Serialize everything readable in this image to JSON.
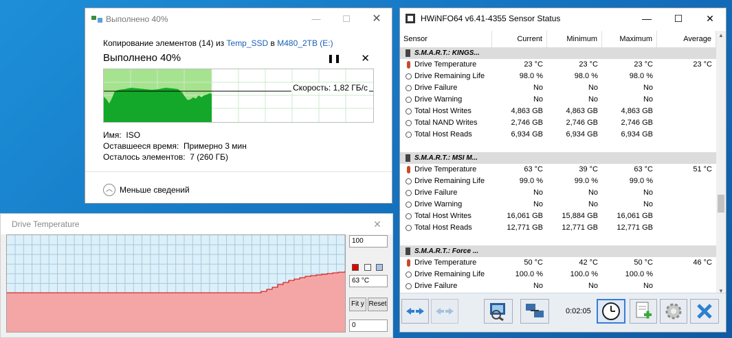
{
  "copy_dialog": {
    "title": "Выполнено 40%",
    "line_prefix": "Копирование элементов (14) из ",
    "source": "Temp_SSD",
    "line_mid": " в ",
    "destination": "M480_2TB (E:)",
    "heading": "Выполнено 40%",
    "pause_icon": "pause-icon",
    "close_icon": "close-icon",
    "speed_text": "Скорость: 1,82 ГБ/с",
    "progress_fraction": 0.4,
    "name_label": "Имя:",
    "name_value": "ISO",
    "time_label": "Оставшееся время:",
    "time_value": "Примерно 3 мин",
    "items_label": "Осталось элементов:",
    "items_value": "7 (260 ГБ)",
    "less_details": "Меньше сведений"
  },
  "temp_window": {
    "title": "Drive Temperature",
    "max_value": "100",
    "current_value": "63 °C",
    "min_value": "0",
    "fit_label": "Fit y",
    "reset_label": "Reset",
    "colors": {
      "fill": "#f4a6a6",
      "line": "#d40000",
      "background": "#dcf0fa",
      "grid": "#a8c8dc"
    }
  },
  "hwinfo": {
    "title": "HWiNFO64 v6.41-4355 Sensor Status",
    "columns": [
      "Sensor",
      "Current",
      "Minimum",
      "Maximum",
      "Average"
    ],
    "rows": [
      {
        "type": "group",
        "name": "S.M.A.R.T.: KINGS..."
      },
      {
        "type": "temp",
        "name": "Drive Temperature",
        "cur": "23 °C",
        "min": "23 °C",
        "max": "23 °C",
        "avg": "23 °C"
      },
      {
        "type": "clock",
        "name": "Drive Remaining Life",
        "cur": "98.0 %",
        "min": "98.0 %",
        "max": "98.0 %",
        "avg": ""
      },
      {
        "type": "clock",
        "name": "Drive Failure",
        "cur": "No",
        "min": "No",
        "max": "No",
        "avg": ""
      },
      {
        "type": "clock",
        "name": "Drive Warning",
        "cur": "No",
        "min": "No",
        "max": "No",
        "avg": ""
      },
      {
        "type": "clock",
        "name": "Total Host Writes",
        "cur": "4,863 GB",
        "min": "4,863 GB",
        "max": "4,863 GB",
        "avg": ""
      },
      {
        "type": "clock",
        "name": "Total NAND Writes",
        "cur": "2,746 GB",
        "min": "2,746 GB",
        "max": "2,746 GB",
        "avg": ""
      },
      {
        "type": "clock",
        "name": "Total Host Reads",
        "cur": "6,934 GB",
        "min": "6,934 GB",
        "max": "6,934 GB",
        "avg": ""
      },
      {
        "type": "blank"
      },
      {
        "type": "group",
        "name": "S.M.A.R.T.: MSI M..."
      },
      {
        "type": "temp",
        "name": "Drive Temperature",
        "cur": "63 °C",
        "min": "39 °C",
        "max": "63 °C",
        "avg": "51 °C"
      },
      {
        "type": "clock",
        "name": "Drive Remaining Life",
        "cur": "99.0 %",
        "min": "99.0 %",
        "max": "99.0 %",
        "avg": ""
      },
      {
        "type": "clock",
        "name": "Drive Failure",
        "cur": "No",
        "min": "No",
        "max": "No",
        "avg": ""
      },
      {
        "type": "clock",
        "name": "Drive Warning",
        "cur": "No",
        "min": "No",
        "max": "No",
        "avg": ""
      },
      {
        "type": "clock",
        "name": "Total Host Writes",
        "cur": "16,061 GB",
        "min": "15,884 GB",
        "max": "16,061 GB",
        "avg": ""
      },
      {
        "type": "clock",
        "name": "Total Host Reads",
        "cur": "12,771 GB",
        "min": "12,771 GB",
        "max": "12,771 GB",
        "avg": ""
      },
      {
        "type": "blank"
      },
      {
        "type": "group",
        "name": "S.M.A.R.T.: Force ..."
      },
      {
        "type": "temp",
        "name": "Drive Temperature",
        "cur": "50 °C",
        "min": "42 °C",
        "max": "50 °C",
        "avg": "46 °C"
      },
      {
        "type": "clock",
        "name": "Drive Remaining Life",
        "cur": "100.0 %",
        "min": "100.0 %",
        "max": "100.0 %",
        "avg": ""
      },
      {
        "type": "clock",
        "name": "Drive Failure",
        "cur": "No",
        "min": "No",
        "max": "No",
        "avg": ""
      }
    ],
    "elapsed": "0:02:05"
  }
}
